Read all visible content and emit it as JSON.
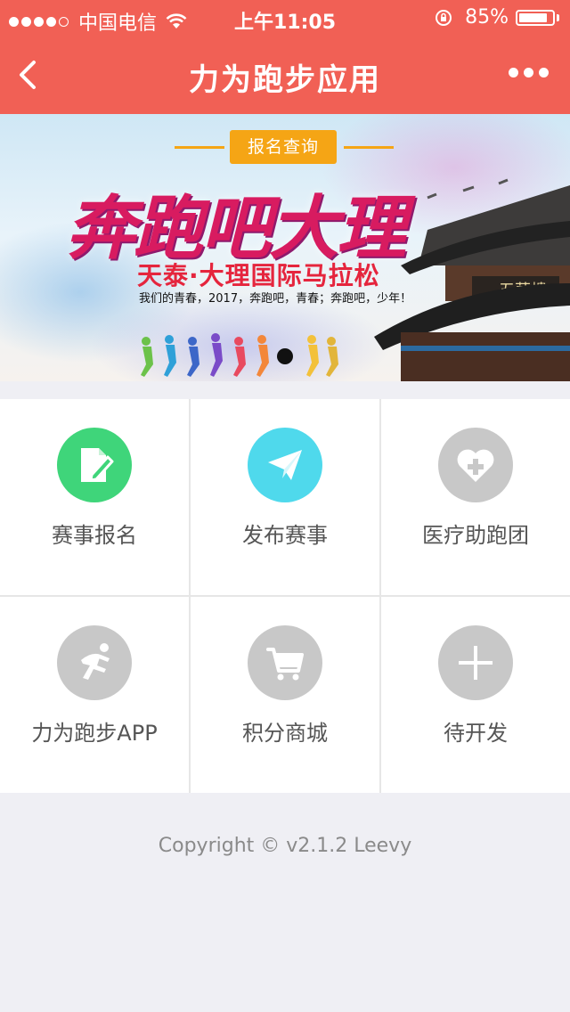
{
  "status_bar": {
    "carrier": "中国电信",
    "time": "上午11:05",
    "battery": "85%",
    "battery_level": 0.85,
    "signal_bars": 4,
    "signal_total": 5
  },
  "nav": {
    "title": "力为跑步应用",
    "back_icon": "chevron-left-icon",
    "more_icon": "more-dots-icon"
  },
  "banner": {
    "tag": "报名查询",
    "headline": "奔跑吧大理",
    "subtitle": "天泰·大理国际马拉松",
    "slogan": "我们的青春，2017，奔跑吧，青春；奔跑吧，少年！",
    "pagoda_sign": "五華樓",
    "slides": 1,
    "active_slide": 1
  },
  "grid": {
    "items": [
      {
        "label": "赛事报名",
        "icon": "document-edit-icon",
        "color": "#3fd57a"
      },
      {
        "label": "发布赛事",
        "icon": "paper-plane-icon",
        "color": "#4fd9ec"
      },
      {
        "label": "医疗助跑团",
        "icon": "heart-plus-icon",
        "color": "#c8c8c8"
      },
      {
        "label": "力为跑步APP",
        "icon": "runner-icon",
        "color": "#c8c8c8"
      },
      {
        "label": "积分商城",
        "icon": "shopping-cart-icon",
        "color": "#c8c8c8"
      },
      {
        "label": "待开发",
        "icon": "plus-icon",
        "color": "#c8c8c8"
      }
    ]
  },
  "footer": {
    "copyright": "Copyright © v2.1.2 Leevy"
  },
  "colors": {
    "accent": "#f16055",
    "tag": "#f5a515"
  }
}
